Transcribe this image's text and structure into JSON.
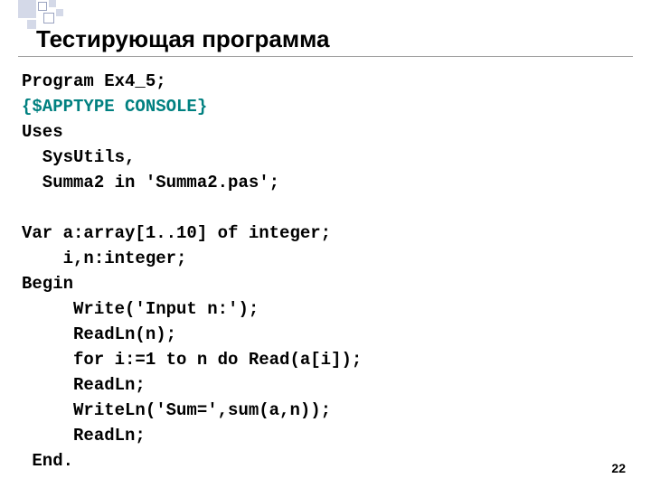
{
  "title": "Тестирующая программа",
  "code": {
    "l1": "Program Ex4_5;",
    "l2": "{$APPTYPE CONSOLE}",
    "l3": "Uses",
    "l4": "  SysUtils,",
    "l5": "  Summa2 in 'Summa2.pas';",
    "l6": "",
    "l7": "Var a:array[1..10] of integer;",
    "l8": "    i,n:integer;",
    "l9": "Begin",
    "l10": "     Write('Input n:');",
    "l11": "     ReadLn(n);",
    "l12": "     for i:=1 to n do Read(a[i]);",
    "l13": "     ReadLn;",
    "l14": "     WriteLn('Sum=',sum(a,n));",
    "l15": "     ReadLn;",
    "l16": " End."
  },
  "page_number": "22"
}
